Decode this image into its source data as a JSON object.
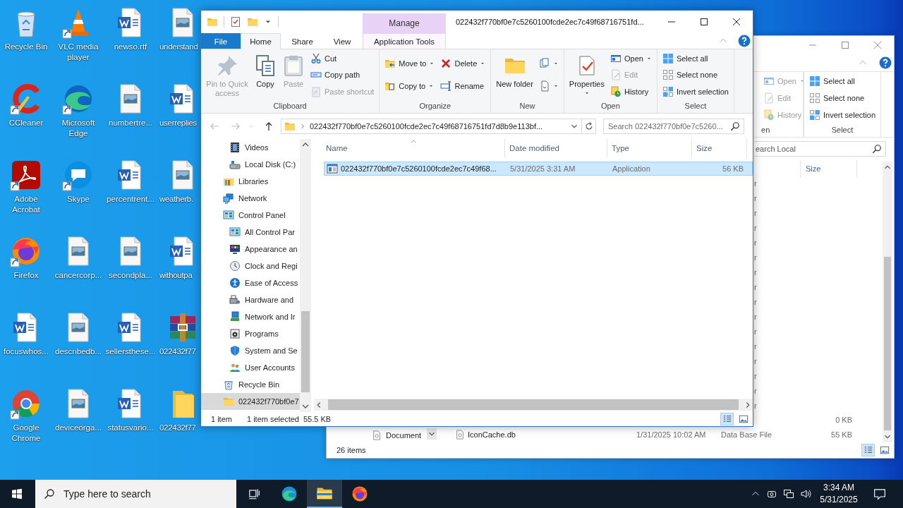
{
  "desktop": {
    "icons": [
      {
        "label": "Recycle Bin",
        "shortcut": false
      },
      {
        "label": "VLC media player",
        "shortcut": true
      },
      {
        "label": "newso.rtf",
        "shortcut": false
      },
      {
        "label": "understand",
        "shortcut": false
      },
      {
        "label": "CCleaner",
        "shortcut": true
      },
      {
        "label": "Microsoft Edge",
        "shortcut": true
      },
      {
        "label": "numbertre...",
        "shortcut": false
      },
      {
        "label": "userreplies",
        "shortcut": false
      },
      {
        "label": "Adobe Acrobat",
        "shortcut": true
      },
      {
        "label": "Skype",
        "shortcut": true
      },
      {
        "label": "percentrent...",
        "shortcut": false
      },
      {
        "label": "weatherb.",
        "shortcut": false
      },
      {
        "label": "Firefox",
        "shortcut": true
      },
      {
        "label": "cancercorp...",
        "shortcut": false
      },
      {
        "label": "secondpla...",
        "shortcut": false
      },
      {
        "label": "withoutpa",
        "shortcut": false
      },
      {
        "label": "focuswhos...",
        "shortcut": false
      },
      {
        "label": "describedb...",
        "shortcut": false
      },
      {
        "label": "sellersthese...",
        "shortcut": false
      },
      {
        "label": "022432f77",
        "shortcut": false
      },
      {
        "label": "Google Chrome",
        "shortcut": true
      },
      {
        "label": "deviceorga...",
        "shortcut": false
      },
      {
        "label": "statusvario...",
        "shortcut": false
      },
      {
        "label": "022432f77",
        "shortcut": false
      }
    ]
  },
  "back_window": {
    "ribbon": {
      "groups": [
        {
          "label": "en",
          "columns": [
            [
              {
                "label": "Open",
                "disabled": true,
                "dropdown": true
              },
              {
                "label": "Edit",
                "disabled": true,
                "dropdown": false
              },
              {
                "label": "History",
                "disabled": true,
                "dropdown": false
              }
            ]
          ]
        },
        {
          "label": "Select",
          "columns": [
            [
              {
                "label": "Select all",
                "disabled": false,
                "dropdown": false
              },
              {
                "label": "Select none",
                "disabled": false,
                "dropdown": false
              },
              {
                "label": "Invert selection",
                "disabled": false,
                "dropdown": false
              }
            ]
          ]
        }
      ]
    },
    "search": {
      "placeholder": "earch Local"
    },
    "nav": {
      "items": [
        {
          "label": "Document"
        }
      ]
    },
    "file_list": {
      "columns": [
        {
          "label": "Size"
        }
      ],
      "rows": [
        {
          "type": "r"
        },
        {
          "type": "r"
        },
        {
          "type": "r"
        },
        {
          "type": "r"
        },
        {
          "type": "r"
        },
        {
          "type": "r"
        },
        {
          "type": "r"
        },
        {
          "type": "r"
        },
        {
          "type": "r"
        },
        {
          "type": "r"
        },
        {
          "type": "r"
        },
        {
          "type": "r"
        },
        {
          "type": "r"
        },
        {
          "type": "r"
        },
        {
          "type": "r"
        },
        {
          "type": "r"
        },
        {
          "size": "0 KB"
        },
        {
          "name": "IconCache.db",
          "date_modified": "1/31/2025 10:02 AM",
          "type": "Data Base File",
          "size": "55 KB"
        }
      ]
    },
    "status_bar": {
      "item_count": "26 items"
    },
    "view_buttons": [
      {
        "selected": true
      },
      {
        "selected": false
      }
    ]
  },
  "front_window": {
    "context_tab": "Manage",
    "title": "022432f770bf0e7c5260100fcde2ec7c49f68716751fd...",
    "tabs": [
      {
        "label": "File",
        "kind": "file",
        "selected": false
      },
      {
        "label": "Home",
        "kind": "normal",
        "selected": true
      },
      {
        "label": "Share",
        "kind": "normal",
        "selected": false
      },
      {
        "label": "View",
        "kind": "normal",
        "selected": false
      },
      {
        "label": "Application Tools",
        "kind": "contextual",
        "selected": false
      }
    ],
    "ribbon": {
      "groups": [
        {
          "label": "Clipboard",
          "columns": [
            [
              {
                "label": "Pin to Quick access",
                "kind": "large",
                "disabled": true,
                "dropdown": false
              }
            ],
            [
              {
                "label": "Copy",
                "kind": "large",
                "disabled": false,
                "dropdown": false
              }
            ],
            [
              {
                "label": "Paste",
                "kind": "large",
                "disabled": true,
                "dropdown": false
              }
            ],
            [
              {
                "label": "Cut",
                "kind": "small",
                "disabled": false,
                "dropdown": false
              },
              {
                "label": "Copy path",
                "kind": "small",
                "disabled": false,
                "dropdown": false
              },
              {
                "label": "Paste shortcut",
                "kind": "small",
                "disabled": true,
                "dropdown": false
              }
            ]
          ]
        },
        {
          "label": "Organize",
          "columns": [
            [
              {
                "label": "Move to",
                "kind": "small",
                "disabled": false,
                "dropdown": true
              },
              {
                "label": "Copy to",
                "kind": "small",
                "disabled": false,
                "dropdown": true
              }
            ],
            [
              {
                "label": "Delete",
                "kind": "small",
                "disabled": false,
                "dropdown": true
              },
              {
                "label": "Rename",
                "kind": "small",
                "disabled": false,
                "dropdown": false
              }
            ]
          ]
        },
        {
          "label": "New",
          "columns": [
            [
              {
                "label": "New folder",
                "kind": "large",
                "disabled": false,
                "dropdown": false
              }
            ],
            [
              {
                "kind": "small",
                "disabled": false,
                "dropdown": true
              },
              {
                "kind": "small",
                "disabled": false,
                "dropdown": true
              }
            ]
          ]
        },
        {
          "label": "Open",
          "columns": [
            [
              {
                "label": "Properties",
                "kind": "large",
                "disabled": false,
                "dropdown": true
              }
            ],
            [
              {
                "label": "Open",
                "kind": "small",
                "disabled": false,
                "dropdown": true
              },
              {
                "label": "Edit",
                "kind": "small",
                "disabled": true,
                "dropdown": false
              },
              {
                "label": "History",
                "kind": "small",
                "disabled": false,
                "dropdown": false
              }
            ]
          ]
        },
        {
          "label": "Select",
          "columns": [
            [
              {
                "label": "Select all",
                "kind": "small",
                "disabled": false,
                "dropdown": false
              },
              {
                "label": "Select none",
                "kind": "small",
                "disabled": false,
                "dropdown": false
              },
              {
                "label": "Invert selection",
                "kind": "small",
                "disabled": false,
                "dropdown": false
              }
            ]
          ]
        }
      ]
    },
    "address": {
      "buttons": [
        {
          "disabled": true
        },
        {
          "disabled": true
        },
        {
          "disabled": true
        },
        {
          "disabled": false
        }
      ],
      "path": "022432f770bf0e7c5260100fcde2ec7c49f68716751fd7d8b9e113bf...",
      "search_placeholder": "Search 022432f770bf0e7c5260..."
    },
    "nav": {
      "items": [
        {
          "children": [
            {
              "label": "Videos",
              "selected": false
            },
            {
              "label": "Local Disk (C:)",
              "selected": false
            }
          ]
        },
        {
          "label": "Libraries",
          "selected": false
        },
        {
          "label": "Network",
          "selected": false
        },
        {
          "label": "Control Panel",
          "selected": false,
          "children": [
            {
              "label": "All Control Par",
              "selected": false
            },
            {
              "label": "Appearance an",
              "selected": false
            },
            {
              "label": "Clock and Regi",
              "selected": false
            },
            {
              "label": "Ease of Access",
              "selected": false
            },
            {
              "label": "Hardware and",
              "selected": false
            },
            {
              "label": "Network and Ir",
              "selected": false
            },
            {
              "label": "Programs",
              "selected": false
            },
            {
              "label": "System and Se",
              "selected": false
            },
            {
              "label": "User Accounts",
              "selected": false
            }
          ]
        },
        {
          "label": "Recycle Bin",
          "selected": false
        },
        {
          "label": "022432f770bf0e7",
          "selected": true
        }
      ]
    },
    "file_list": {
      "columns": [
        {
          "label": "Name",
          "sorted": true
        },
        {
          "label": "Date modified",
          "sorted": false
        },
        {
          "label": "Type",
          "sorted": false
        },
        {
          "label": "Size",
          "sorted": false
        }
      ],
      "rows": [
        {
          "name": "022432f770bf0e7c5260100fcde2ec7c49f68...",
          "date_modified": "5/31/2025 3:31 AM",
          "type": "Application",
          "size": "56 KB",
          "selected": true
        }
      ]
    },
    "status_bar": {
      "item_count": "1 item",
      "selection": "1 item selected",
      "selection_size": "55.5 KB"
    },
    "view_buttons": [
      {
        "selected": true
      },
      {
        "selected": false
      }
    ]
  },
  "taskbar": {
    "search_placeholder": "Type here to search",
    "apps": [
      {
        "selected": false
      },
      {
        "selected": false
      },
      {
        "selected": true
      },
      {
        "selected": false
      }
    ],
    "clock": {
      "time": "3:34 AM",
      "date": "5/31/2025"
    }
  }
}
